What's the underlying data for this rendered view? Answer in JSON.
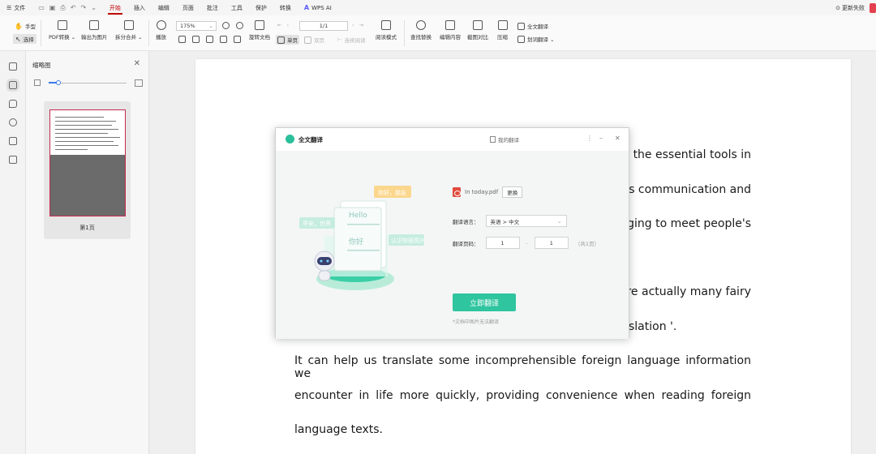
{
  "menubar": {
    "file": "文件",
    "tabs": [
      {
        "label": "开始",
        "active": true
      },
      {
        "label": "插入"
      },
      {
        "label": "编辑"
      },
      {
        "label": "页面"
      },
      {
        "label": "批注"
      },
      {
        "label": "工具"
      },
      {
        "label": "保护"
      },
      {
        "label": "转换"
      },
      {
        "label": "WPS AI"
      }
    ],
    "update_status": "更新失败",
    "accent": "#c00000"
  },
  "toolbar": {
    "hand": "手型",
    "select": "选择",
    "pdf_convert": "PDF转换",
    "export_image": "输出为图片",
    "split_merge": "拆分合并",
    "play": "播放",
    "zoom_value": "175%",
    "rotate": "旋转文档",
    "single_page": "单页",
    "dual_page": "双页",
    "continuous": "连续阅读",
    "read_mode": "阅读模式",
    "page_value": "1/1",
    "find_replace": "查找替换",
    "edit_content": "编辑内容",
    "crop_compare": "截图对比",
    "compress": "压缩",
    "full_translate": "全文翻译",
    "word_translate": "划词翻译"
  },
  "thumbnails": {
    "title": "缩略图",
    "zoom_fraction": 0.12,
    "page_label": "第1页"
  },
  "document": {
    "lines": [
      "the essential tools in",
      "s communication and",
      "ging to meet people's",
      "re actually many fairy",
      "slation '.",
      "It can help us translate some incomprehensible foreign language information we",
      "encounter in life more quickly, providing convenience when reading foreign",
      "language texts."
    ]
  },
  "dialog": {
    "title": "全文翻译",
    "my_translations": "我的翻译",
    "illus_bubble1": "你好，朋友",
    "illus_bubble2": "早安，世界",
    "illus_bubble3": "认识你很高兴",
    "illus_hello": "Hello",
    "illus_nihao": "你好",
    "file_name": "In today.pdf",
    "change_btn": "更换",
    "lang_label": "翻译语言：",
    "lang_value": "英语 > 中文",
    "pages_label": "翻译页码：",
    "page_from": "1",
    "page_to": "1",
    "total_pages": "（共1页）",
    "translate_btn": "立即翻译",
    "note": "*文档中图片无法翻译",
    "accent": "#2fc59f"
  }
}
